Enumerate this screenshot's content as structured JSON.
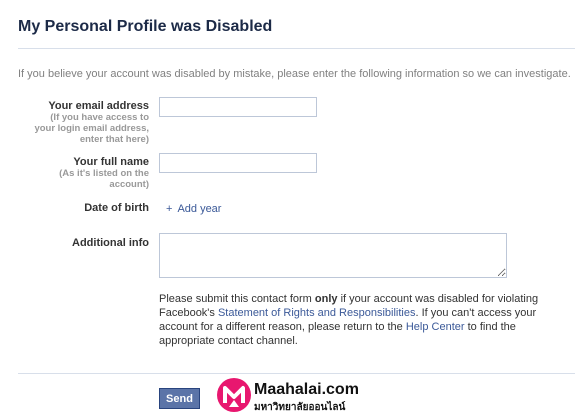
{
  "header": {
    "title": "My Personal Profile was Disabled"
  },
  "intro": "If you believe your account was disabled by mistake, please enter the following information so we can investigate.",
  "form": {
    "email": {
      "label": "Your email address",
      "hint_lines": [
        "(If you have access to",
        "your login email address,",
        "enter that here)"
      ],
      "value": ""
    },
    "fullname": {
      "label": "Your full name",
      "hint_lines": [
        "(As it's listed on the",
        "account)"
      ],
      "value": ""
    },
    "dob": {
      "label": "Date of birth",
      "add_year_label": "Add year",
      "add_year_icon": "+"
    },
    "additional": {
      "label": "Additional info",
      "value": ""
    }
  },
  "notice": {
    "part1": "Please submit this contact form ",
    "bold": "only",
    "part2": " if your account was disabled for violating Facebook's ",
    "link1": "Statement of Rights and Responsibilities",
    "part3": ". If you can't access your account for a different reason, please return to the ",
    "link2": "Help Center",
    "part4": " to find the appropriate contact channel."
  },
  "actions": {
    "send_label": "Send"
  },
  "watermark": {
    "name": "Maahalai.com",
    "tagline": "มหาวิทยาลัยออนไลน์"
  },
  "colors": {
    "link": "#3b5998",
    "button": "#5b74a8",
    "title": "#1c2a47",
    "watermark": "#e8176f"
  }
}
